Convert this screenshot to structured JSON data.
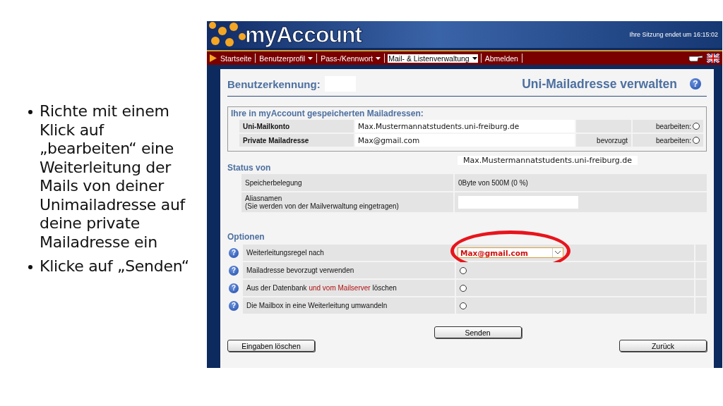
{
  "bullets": [
    "Richte mit einem Klick auf „bearbeiten“ eine Weiterleitung der Mails von deiner Unimailadresse auf deine private Mailadresse ein",
    "Klicke auf „Senden“"
  ],
  "header": {
    "logo": "myAccount",
    "session": "Ihre Sitzung endet um 16:15:02"
  },
  "nav": [
    {
      "label": "Startseite",
      "dropdown": false,
      "selected": false
    },
    {
      "label": "Benutzerprofil",
      "dropdown": true,
      "selected": false
    },
    {
      "label": "Pass-/Kennwort",
      "dropdown": true,
      "selected": false
    },
    {
      "label": "Mail- & Listenverwaltung",
      "dropdown": true,
      "selected": true
    },
    {
      "label": "Abmelden",
      "dropdown": false,
      "selected": false
    }
  ],
  "page": {
    "user_label": "Benutzerkennung:",
    "title": "Uni-Mailadresse verwalten",
    "help": "?"
  },
  "stored": {
    "heading": "Ihre in myAccount gespeicherten Mailadressen:",
    "rows": [
      {
        "label": "Uni-Mailkonto",
        "address": "Max.Mustermannatstudents.uni-freiburg.de",
        "action": "bearbeiten:",
        "checked": false
      },
      {
        "label": "Private Mailadresse",
        "address": "Max@gmail.com",
        "note": "bevorzugt",
        "action": "bearbeiten:",
        "checked": false
      }
    ]
  },
  "status": {
    "heading": "Status von",
    "address": "Max.Mustermannatstudents.uni-freiburg.de",
    "rows": [
      {
        "label": "Speicherbelegung",
        "value": "0Byte von 500M (0 %)"
      },
      {
        "label": "Aliasnamen",
        "sublabel": "(Sie werden von der Mailverwaltung eingetragen)"
      }
    ]
  },
  "options": {
    "heading": "Optionen",
    "rows": [
      {
        "kind": "select",
        "help": "?",
        "parts": [
          {
            "text": "Weiterleitungsregel nach",
            "accent": false
          }
        ],
        "value": "Max@gmail.com",
        "circled": true
      },
      {
        "kind": "radio",
        "help": "?",
        "parts": [
          {
            "text": "Mailadresse bevorzugt verwenden",
            "accent": false
          }
        ],
        "checked": false,
        "circled": false
      },
      {
        "kind": "radio",
        "help": "?",
        "parts": [
          {
            "text": "Aus der Datenbank ",
            "accent": false
          },
          {
            "text": "und vom Mailserver",
            "accent": true
          },
          {
            "text": " löschen",
            "accent": false
          }
        ],
        "checked": false,
        "circled": false
      },
      {
        "kind": "radio",
        "help": "?",
        "parts": [
          {
            "text": "Die Mailbox in eine Weiterleitung umwandeln",
            "accent": false
          }
        ],
        "checked": false,
        "circled": false
      }
    ]
  },
  "buttons": {
    "send": "Senden",
    "clear": "Eingaben löschen",
    "back": "Zurück"
  }
}
